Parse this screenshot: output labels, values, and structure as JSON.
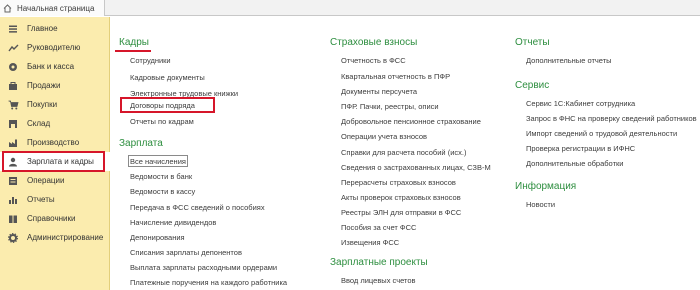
{
  "tab": {
    "label": "Начальная страница"
  },
  "sidebar": {
    "items": [
      {
        "label": "Главное",
        "icon": "menu-icon"
      },
      {
        "label": "Руководителю",
        "icon": "trend-chart-icon"
      },
      {
        "label": "Банк и касса",
        "icon": "bank-icon"
      },
      {
        "label": "Продажи",
        "icon": "sales-icon"
      },
      {
        "label": "Покупки",
        "icon": "cart-icon"
      },
      {
        "label": "Склад",
        "icon": "warehouse-icon"
      },
      {
        "label": "Производство",
        "icon": "factory-icon"
      },
      {
        "label": "Зарплата и кадры",
        "icon": "person-icon"
      },
      {
        "label": "Операции",
        "icon": "operations-icon"
      },
      {
        "label": "Отчеты",
        "icon": "reports-icon"
      },
      {
        "label": "Справочники",
        "icon": "books-icon"
      },
      {
        "label": "Администрирование",
        "icon": "gear-icon"
      }
    ]
  },
  "col1": {
    "kadry": {
      "title": "Кадры",
      "links": [
        "Сотрудники",
        "Кадровые документы",
        "Электронные трудовые книжки",
        "Договоры подряда",
        "Отчеты по кадрам"
      ]
    },
    "zarplata": {
      "title": "Зарплата",
      "links": [
        "Все начисления",
        "Ведомости в банк",
        "Ведомости в кассу",
        "Передача в ФСС сведений о пособиях",
        "Начисление дивидендов",
        "Депонирования",
        "Списания зарплаты депонентов",
        "Выплата зарплаты расходными ордерами",
        "Платежные поручения на каждого работника"
      ]
    }
  },
  "col2": {
    "strah": {
      "title": "Страховые взносы",
      "links": [
        "Отчетность в ФСС",
        "Квартальная отчетность в ПФР",
        "Документы персучета",
        "ПФР. Пачки, реестры, описи",
        "Добровольное пенсионное страхование",
        "Операции учета взносов",
        "Справки для расчета пособий (исх.)",
        "Сведения о застрахованных лицах, СЗВ-М",
        "Перерасчеты страховых взносов",
        "Акты проверок страховых взносов",
        "Реестры ЭЛН для отправки в ФСС",
        "Пособия за счет ФСС",
        "Извещения ФСС"
      ]
    },
    "proekty": {
      "title": "Зарплатные проекты",
      "links": [
        "Ввод лицевых счетов"
      ]
    }
  },
  "col3": {
    "otchety": {
      "title": "Отчеты",
      "links": [
        "Дополнительные отчеты"
      ]
    },
    "servis": {
      "title": "Сервис",
      "links": [
        "Сервис 1С:Кабинет сотрудника",
        "Запрос в ФНС на проверку сведений работников",
        "Импорт сведений о трудовой деятельности",
        "Проверка регистрации в ИФНС",
        "Дополнительные обработки"
      ]
    },
    "info": {
      "title": "Информация",
      "links": [
        "Новости"
      ]
    }
  },
  "colors": {
    "accent_red": "#d6162a",
    "section_green": "#2d8e3f",
    "sidebar_bg": "#fbecae"
  }
}
